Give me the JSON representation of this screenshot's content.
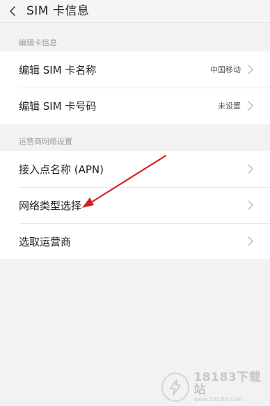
{
  "header": {
    "title": "SIM  卡信息",
    "back_icon": "chevron-left-icon"
  },
  "sim_section": {
    "label": "编辑卡信息",
    "rows": [
      {
        "label": "编辑 SIM 卡名称",
        "value": "中国移动"
      },
      {
        "label": "编辑 SIM 卡号码",
        "value": "未设置"
      }
    ]
  },
  "network_section": {
    "label": "运营商网络设置",
    "rows": [
      {
        "label": "接入点名称 (APN)"
      },
      {
        "label": "网络类型选择"
      },
      {
        "label": "选取运营商"
      }
    ]
  },
  "annotation": {
    "color": "#d42020"
  },
  "watermark": {
    "main": "18183下载站",
    "sub": "www.18183.com"
  },
  "colors": {
    "background": "#f2f2f2",
    "row_background": "#ffffff",
    "chevron": "#b8b8b8",
    "section_label": "#9a9a9a"
  }
}
